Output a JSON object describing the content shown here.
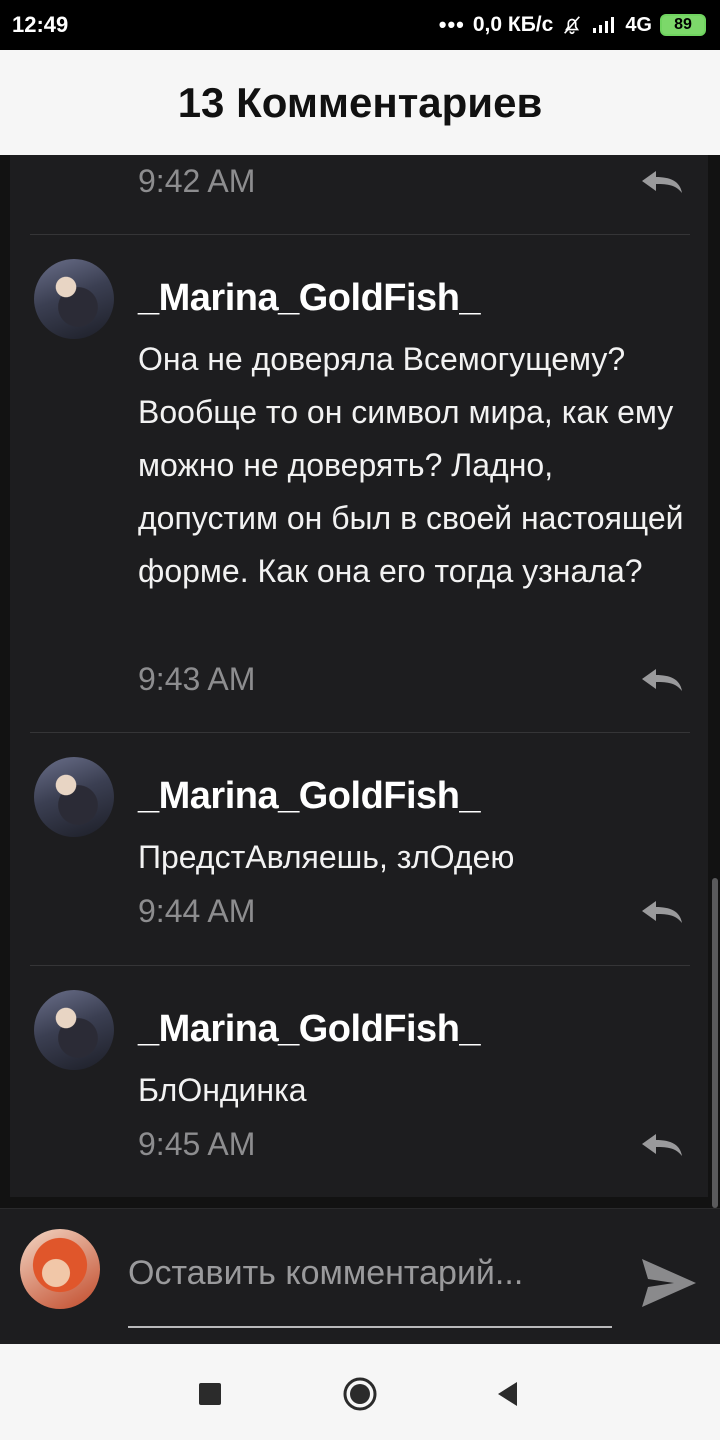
{
  "status_bar": {
    "time": "12:49",
    "dots": "•••",
    "net_speed": "0,0 КБ/с",
    "net_type": "4G",
    "battery": "89"
  },
  "header": {
    "title": "13 Комментариев"
  },
  "comments": [
    {
      "time": "9:42 AM"
    },
    {
      "author": "_Marina_GoldFish_",
      "text": "Она не доверяла Всемогущему? Вообще то он символ мира, как ему можно не доверять? Ладно, допустим он был в своей настоящей форме. Как она его тогда узнала?",
      "time": "9:43 AM"
    },
    {
      "author": "_Marina_GoldFish_",
      "text": "ПредстАвляешь, злОдею",
      "time": "9:44 AM"
    },
    {
      "author": "_Marina_GoldFish_",
      "text": "БлОндинка",
      "time": "9:45 AM"
    }
  ],
  "input": {
    "placeholder": "Оставить комментарий..."
  },
  "icons": {
    "reply": "reply-arrow-icon",
    "send": "send-icon",
    "nav_recent": "square-icon",
    "nav_home": "circle-icon",
    "nav_back": "triangle-back-icon"
  },
  "colors": {
    "header_bg": "#f6f6f6",
    "panel_bg": "#1d1d1f",
    "battery": "#7cd86a"
  }
}
